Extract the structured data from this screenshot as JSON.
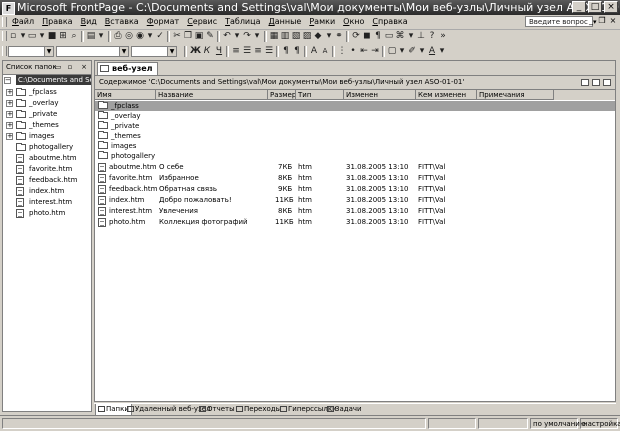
{
  "window": {
    "title": "Microsoft FrontPage - C:\\Documents and Settings\\val\\Мои документы\\Мои веб-узлы\\Личный узел ASO-01-01"
  },
  "menu": [
    "Файл",
    "Правка",
    "Вид",
    "Вставка",
    "Формат",
    "Сервис",
    "Таблица",
    "Данные",
    "Рамки",
    "Окно",
    "Справка"
  ],
  "help_placeholder": "Введите вопрос",
  "folder_list": {
    "title": "Список папок",
    "root": "C:\\Documents and Settings",
    "items": [
      "_fpclass",
      "_overlay",
      "_private",
      "_themes",
      "images",
      "photogallery",
      "aboutme.htm",
      "favorite.htm",
      "feedback.htm",
      "index.htm",
      "interest.htm",
      "photo.htm"
    ]
  },
  "main": {
    "tab": "веб-узел",
    "path": "Содержимое 'C:\\Documents and Settings\\val\\Мои документы\\Мои веб-узлы\\Личный узел ASO-01-01'",
    "columns": [
      "Имя",
      "Название",
      "Размер",
      "Тип",
      "Изменен",
      "Кем изменен",
      "Примечания"
    ],
    "rows": [
      {
        "name": "_fpclass",
        "title": "",
        "size": "",
        "type": "",
        "modified": "",
        "by": "",
        "comment": ""
      },
      {
        "name": "_overlay",
        "title": "",
        "size": "",
        "type": "",
        "modified": "",
        "by": "",
        "comment": ""
      },
      {
        "name": "_private",
        "title": "",
        "size": "",
        "type": "",
        "modified": "",
        "by": "",
        "comment": ""
      },
      {
        "name": "_themes",
        "title": "",
        "size": "",
        "type": "",
        "modified": "",
        "by": "",
        "comment": ""
      },
      {
        "name": "images",
        "title": "",
        "size": "",
        "type": "",
        "modified": "",
        "by": "",
        "comment": ""
      },
      {
        "name": "photogallery",
        "title": "",
        "size": "",
        "type": "",
        "modified": "",
        "by": "",
        "comment": ""
      },
      {
        "name": "aboutme.htm",
        "title": "О себе",
        "size": "7КБ",
        "type": "htm",
        "modified": "31.08.2005 13:10",
        "by": "FITT\\Val",
        "comment": ""
      },
      {
        "name": "favorite.htm",
        "title": "Избранное",
        "size": "8КБ",
        "type": "htm",
        "modified": "31.08.2005 13:10",
        "by": "FITT\\Val",
        "comment": ""
      },
      {
        "name": "feedback.htm",
        "title": "Обратная связь",
        "size": "9КБ",
        "type": "htm",
        "modified": "31.08.2005 13:10",
        "by": "FITT\\Val",
        "comment": ""
      },
      {
        "name": "index.htm",
        "title": "Добро пожаловать!",
        "size": "11КБ",
        "type": "htm",
        "modified": "31.08.2005 13:10",
        "by": "FITT\\Val",
        "comment": ""
      },
      {
        "name": "interest.htm",
        "title": "Увлечения",
        "size": "8КБ",
        "type": "htm",
        "modified": "31.08.2005 13:10",
        "by": "FITT\\Val",
        "comment": ""
      },
      {
        "name": "photo.htm",
        "title": "Коллекция фотографий",
        "size": "11КБ",
        "type": "htm",
        "modified": "31.08.2005 13:10",
        "by": "FITT\\Val",
        "comment": ""
      }
    ]
  },
  "views": [
    "Папки",
    "Удаленный веб-узел",
    "Отчеты",
    "Переходы",
    "Гиперссылки",
    "Задачи"
  ],
  "status": [
    "по умолчанию",
    "настройка"
  ]
}
